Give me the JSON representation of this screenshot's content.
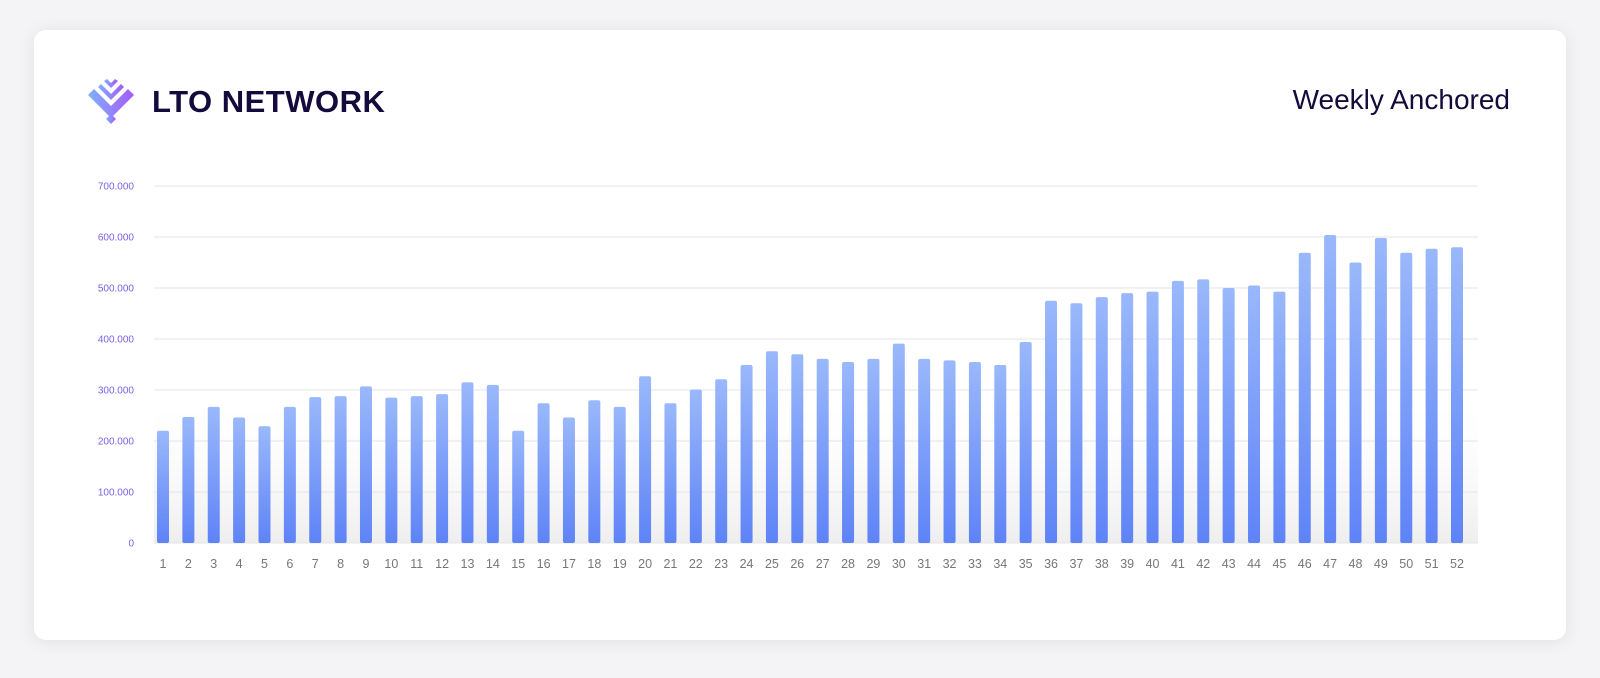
{
  "brand": {
    "name": "LTO NETWORK",
    "logo_icon": "lto-logo-icon"
  },
  "colors": {
    "brand_dark": "#150a3c",
    "bar_top": "#9ab8fb",
    "bar_bottom": "#5e83f7",
    "axis_label": "#7a5fe6",
    "grid": "#e4e4e8"
  },
  "chart_data": {
    "type": "bar",
    "title": "Weekly Anchored",
    "xlabel": "",
    "ylabel": "",
    "ylim": [
      0,
      700000
    ],
    "yticks": [
      0,
      100000,
      200000,
      300000,
      400000,
      500000,
      600000,
      700000
    ],
    "ytick_labels": [
      "0",
      "100.000",
      "200.000",
      "300.000",
      "400.000",
      "500.000",
      "600.000",
      "700.000"
    ],
    "grid": true,
    "categories": [
      "1",
      "2",
      "3",
      "4",
      "5",
      "6",
      "7",
      "8",
      "9",
      "10",
      "11",
      "12",
      "13",
      "14",
      "15",
      "16",
      "17",
      "18",
      "19",
      "20",
      "21",
      "22",
      "23",
      "24",
      "25",
      "26",
      "27",
      "28",
      "29",
      "30",
      "31",
      "32",
      "33",
      "34",
      "35",
      "36",
      "37",
      "38",
      "39",
      "40",
      "41",
      "42",
      "43",
      "44",
      "45",
      "46",
      "47",
      "48",
      "49",
      "50",
      "51",
      "52"
    ],
    "values": [
      220000,
      247000,
      267000,
      246000,
      229000,
      267000,
      286000,
      288000,
      307000,
      285000,
      288000,
      292000,
      315000,
      310000,
      220000,
      274000,
      246000,
      280000,
      267000,
      327000,
      274000,
      301000,
      321000,
      349000,
      376000,
      370000,
      361000,
      355000,
      361000,
      391000,
      361000,
      358000,
      355000,
      349000,
      394000,
      475000,
      470000,
      482000,
      490000,
      493000,
      514000,
      517000,
      500000,
      505000,
      493000,
      569000,
      604000,
      550000,
      598000,
      569000,
      577000,
      580000
    ]
  }
}
